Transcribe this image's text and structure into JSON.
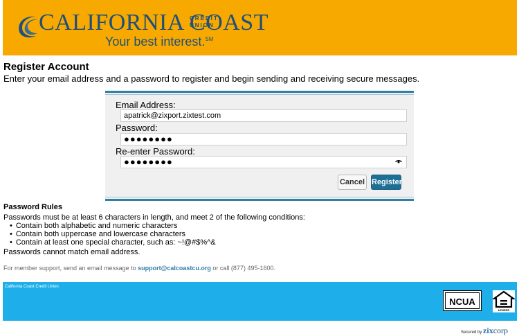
{
  "header": {
    "brand_name": "CALIFORNIA COAST",
    "brand_sub": "CREDIT UNION",
    "tagline": "Your best interest.",
    "tagline_mark": "SM",
    "bg_color": "#f7a900",
    "logo_color": "#1f4f7a"
  },
  "page": {
    "title": "Register Account",
    "subtitle": "Enter your email address and a password to register and begin sending and receiving secure messages."
  },
  "form": {
    "email_label": "Email Address:",
    "email_value": "apatrick@zixport.zixtest.com",
    "password_label": "Password:",
    "password_value": "●●●●●●●●",
    "reenter_label": "Re-enter Password:",
    "reenter_value": "●●●●●●●●",
    "reveal_icon": "eye-icon",
    "cancel_label": "Cancel",
    "register_label": "Register",
    "accent_color": "#2f7fa7"
  },
  "rules": {
    "title": "Password Rules",
    "intro": "Passwords must be at least 6 characters in length, and meet 2 of the following conditions:",
    "items": [
      "Contain both alphabetic and numeric characters",
      "Contain both uppercase and lowercase characters",
      "Contain at least one special character, such as: ~!@#$%^&"
    ],
    "note": "Passwords cannot match email address."
  },
  "support": {
    "prefix": "For member support, send an email message to",
    "email": "support@calcoastcu.org",
    "suffix": "or call (877) 495-1600."
  },
  "footer": {
    "text": "California Coast Credit Union",
    "ncua": "NCUA",
    "ehl": "LENDER",
    "bg_color": "#1eaeea"
  },
  "secured": {
    "label": "Secured by",
    "brand_a": "zix",
    "brand_b": "corp"
  }
}
